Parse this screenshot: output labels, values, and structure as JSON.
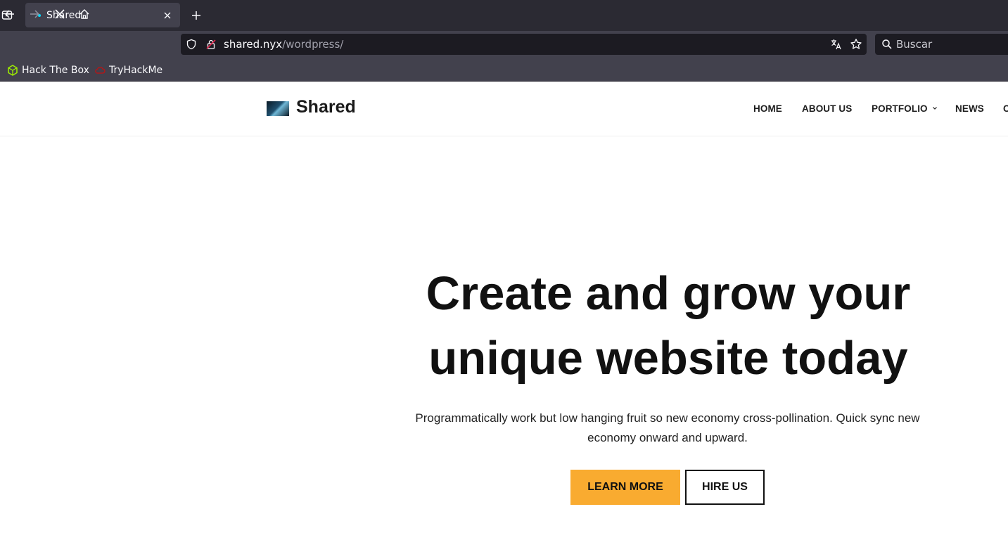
{
  "browser": {
    "tab": {
      "title": "Shared"
    },
    "url": {
      "host": "shared.nyx",
      "path": "/wordpress/"
    },
    "search": {
      "placeholder": "Buscar"
    },
    "bookmarks": [
      {
        "label": "Hack The Box",
        "icon": "htb-cube-icon"
      },
      {
        "label": "TryHackMe",
        "icon": "thm-cloud-icon"
      }
    ]
  },
  "site": {
    "title": "Shared",
    "menu": {
      "home": "HOME",
      "about": "ABOUT US",
      "portfolio": "PORTFOLIO",
      "news": "NEWS",
      "contact": "C"
    }
  },
  "hero": {
    "title_line1": "Create and grow your",
    "title_line2": "unique website today",
    "subtitle_line1": "Programmatically work but low hanging fruit so new economy cross-pollination. Quick sync new",
    "subtitle_line2": "economy onward and upward.",
    "learn_more": "LEARN MORE",
    "hire_us": "HIRE US"
  },
  "colors": {
    "accent": "#f9ab30",
    "chrome_dark": "#2b2a33",
    "chrome_mid": "#42414d"
  }
}
